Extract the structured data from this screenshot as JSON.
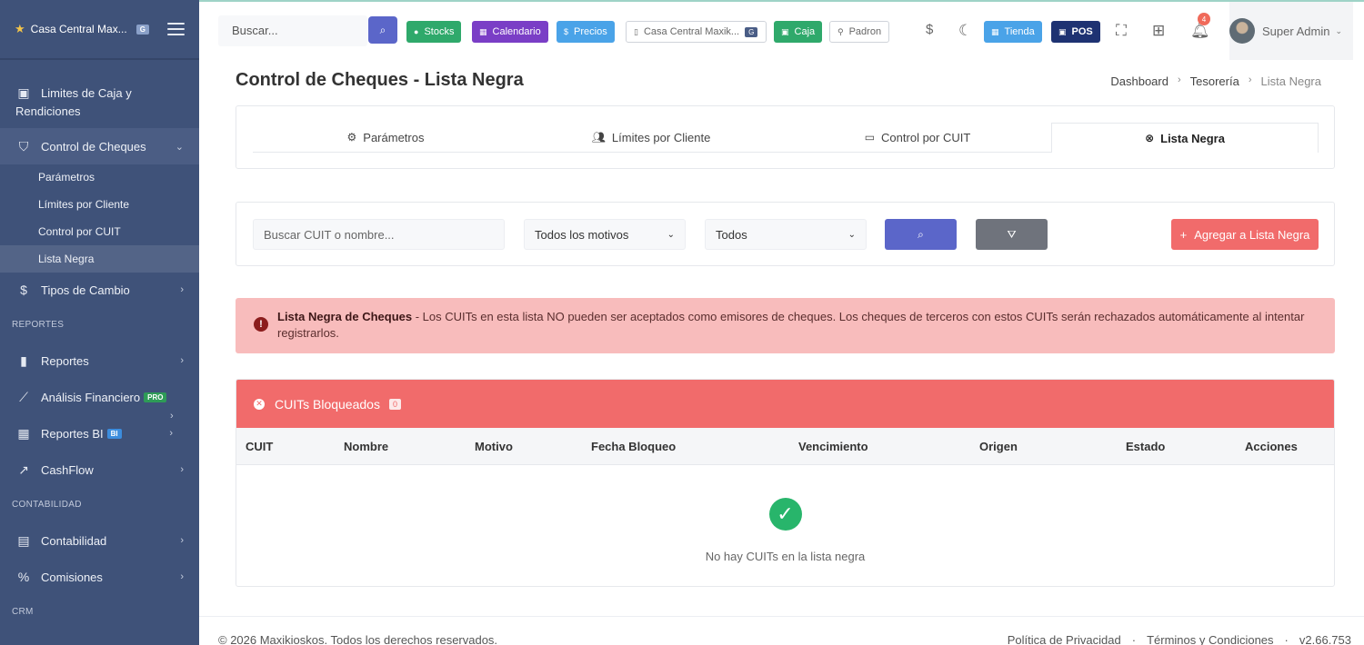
{
  "brand": {
    "name": "Casa Central Max...",
    "badge": "G"
  },
  "sidebar": {
    "items": [
      {
        "label": "Limites de Caja y",
        "label2": "Rendiciones",
        "icon": "cash-register-icon"
      },
      {
        "label": "Control de Cheques",
        "icon": "shield-check-icon"
      },
      {
        "label": "Tipos de Cambio",
        "icon": "dollar-icon"
      }
    ],
    "sub": [
      "Parámetros",
      "Límites por Cliente",
      "Control por CUIT",
      "Lista Negra"
    ],
    "sections": {
      "reportes": "REPORTES",
      "contabilidad": "CONTABILIDAD",
      "crm": "CRM"
    },
    "reportes": [
      {
        "label": "Reportes"
      },
      {
        "label": "Análisis Financiero",
        "pill": "PRO"
      },
      {
        "label": "Reportes BI",
        "pill": "BI"
      },
      {
        "label": "CashFlow"
      }
    ],
    "contabilidad": [
      {
        "label": "Contabilidad"
      },
      {
        "label": "Comisiones"
      }
    ]
  },
  "topbar": {
    "search_placeholder": "Buscar...",
    "buttons": {
      "stocks": "Stocks",
      "calendario": "Calendario",
      "precios": "Precios",
      "sucursal": "Casa Central Maxik...",
      "sucursal_badge": "G",
      "caja": "Caja",
      "padron": "Padron",
      "tienda": "Tienda",
      "pos": "POS"
    },
    "notifications": "4",
    "user": "Super Admin"
  },
  "page": {
    "title": "Control de Cheques - Lista Negra",
    "breadcrumb": [
      "Dashboard",
      "Tesorería",
      "Lista Negra"
    ]
  },
  "tabs": [
    "Parámetros",
    "Límites por Cliente",
    "Control por CUIT",
    "Lista Negra"
  ],
  "filters": {
    "search_placeholder": "Buscar CUIT o nombre...",
    "motivo": "Todos los motivos",
    "estado": "Todos",
    "add_label": "Agregar a Lista Negra"
  },
  "alert": {
    "bold": "Lista Negra de Cheques",
    "text": " - Los CUITs en esta lista NO pueden ser aceptados como emisores de cheques. Los cheques de terceros con estos CUITs serán rechazados automáticamente al intentar registrarlos."
  },
  "table": {
    "title": "CUITs Bloqueados",
    "count": "0",
    "columns": [
      "CUIT",
      "Nombre",
      "Motivo",
      "Fecha Bloqueo",
      "Vencimiento",
      "Origen",
      "Estado",
      "Acciones"
    ],
    "empty": "No hay CUITs en la lista negra"
  },
  "footer": {
    "copyright": "© 2026 Maxikioskos. Todos los derechos reservados.",
    "privacy": "Política de Privacidad",
    "terms": "Términos y Condiciones",
    "version": "v2.66.753"
  },
  "colors": {
    "sidebar": "#3f5279",
    "primary": "#5b66c9",
    "danger": "#f16b6b",
    "success": "#28b56b"
  }
}
